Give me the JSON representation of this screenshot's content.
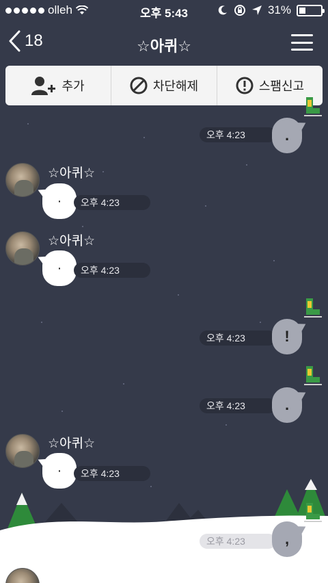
{
  "status_bar": {
    "carrier": "olleh",
    "time": "오후 5:43",
    "battery": "31%",
    "battery_level": 0.31
  },
  "nav": {
    "back_count": "18",
    "title": "☆아퀴☆"
  },
  "actions": [
    {
      "label": "추가",
      "icon": "add-friend-icon"
    },
    {
      "label": "차단해제",
      "icon": "unblock-icon"
    },
    {
      "label": "스팸신고",
      "icon": "report-icon"
    }
  ],
  "messages": [
    {
      "direction": "out",
      "text": ".",
      "time": "오후 4:23"
    },
    {
      "direction": "in",
      "sender": "☆아퀴☆",
      "text": "·",
      "time": "오후 4:23"
    },
    {
      "direction": "in",
      "sender": "☆아퀴☆",
      "text": "·",
      "time": "오후 4:23"
    },
    {
      "direction": "out",
      "text": "!",
      "time": "오후 4:23"
    },
    {
      "direction": "out",
      "text": ".",
      "time": "오후 4:23"
    },
    {
      "direction": "in",
      "sender": "☆아퀴☆",
      "text": "·",
      "time": "오후 4:23"
    },
    {
      "direction": "out",
      "text": ",",
      "time": "오후 4:23"
    }
  ],
  "colors": {
    "background": "#353a4a",
    "outgoing_bubble": "#a5a8b3",
    "incoming_bubble": "#ffffff",
    "time_pill": "#2b2f3c",
    "action_bar": "#f4f4f4"
  }
}
